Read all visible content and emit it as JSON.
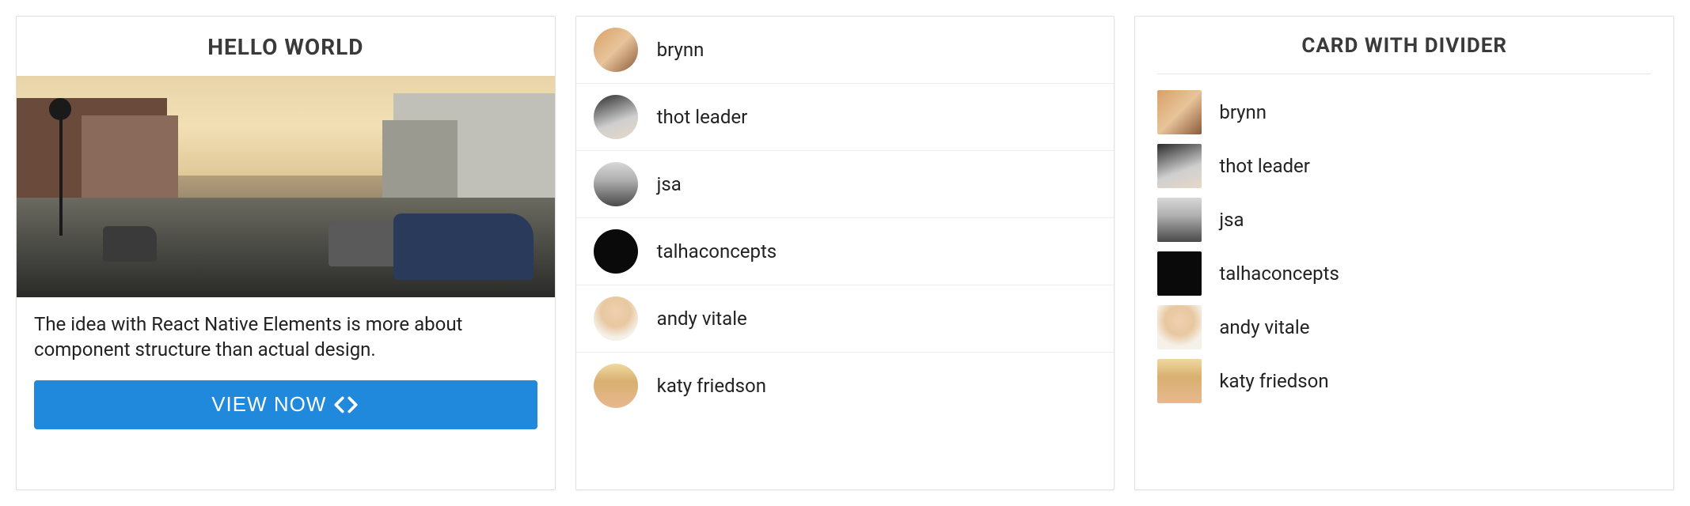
{
  "card1": {
    "title": "HELLO WORLD",
    "body": "The idea with React Native Elements is more about component structure than actual design.",
    "button_label": "VIEW NOW"
  },
  "card2": {
    "items": [
      {
        "name": "brynn",
        "avatar_class": "av-brynn"
      },
      {
        "name": "thot leader",
        "avatar_class": "av-thot"
      },
      {
        "name": "jsa",
        "avatar_class": "av-jsa"
      },
      {
        "name": "talhaconcepts",
        "avatar_class": "av-talha"
      },
      {
        "name": "andy vitale",
        "avatar_class": "av-andy"
      },
      {
        "name": "katy friedson",
        "avatar_class": "av-katy"
      }
    ]
  },
  "card3": {
    "title": "CARD WITH DIVIDER",
    "items": [
      {
        "name": "brynn",
        "avatar_class": "av-brynn"
      },
      {
        "name": "thot leader",
        "avatar_class": "av-thot"
      },
      {
        "name": "jsa",
        "avatar_class": "av-jsa"
      },
      {
        "name": "talhaconcepts",
        "avatar_class": "av-talha"
      },
      {
        "name": "andy vitale",
        "avatar_class": "av-andy"
      },
      {
        "name": "katy friedson",
        "avatar_class": "av-katy"
      }
    ]
  }
}
